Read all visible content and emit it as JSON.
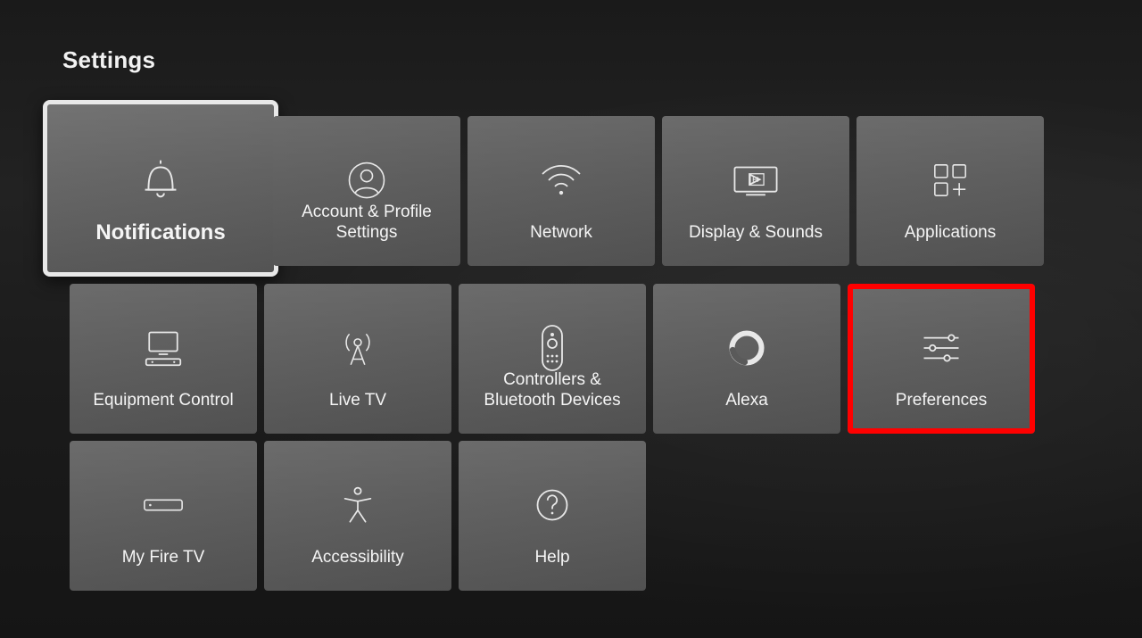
{
  "page": {
    "title": "Settings"
  },
  "tiles": [
    {
      "id": "notifications",
      "label": "Notifications",
      "icon": "bell-icon",
      "selected": true,
      "highlight": false
    },
    {
      "id": "account",
      "label": "Account & Profile Settings",
      "icon": "profile-icon",
      "selected": false,
      "highlight": false
    },
    {
      "id": "network",
      "label": "Network",
      "icon": "wifi-icon",
      "selected": false,
      "highlight": false
    },
    {
      "id": "display",
      "label": "Display & Sounds",
      "icon": "display-icon",
      "selected": false,
      "highlight": false
    },
    {
      "id": "applications",
      "label": "Applications",
      "icon": "apps-icon",
      "selected": false,
      "highlight": false
    },
    {
      "id": "equipment",
      "label": "Equipment Control",
      "icon": "equipment-icon",
      "selected": false,
      "highlight": false
    },
    {
      "id": "livetv",
      "label": "Live TV",
      "icon": "antenna-icon",
      "selected": false,
      "highlight": false
    },
    {
      "id": "controllers",
      "label": "Controllers & Bluetooth Devices",
      "icon": "remote-icon",
      "selected": false,
      "highlight": false
    },
    {
      "id": "alexa",
      "label": "Alexa",
      "icon": "alexa-icon",
      "selected": false,
      "highlight": false
    },
    {
      "id": "preferences",
      "label": "Preferences",
      "icon": "sliders-icon",
      "selected": false,
      "highlight": true
    },
    {
      "id": "myfiretv",
      "label": "My Fire TV",
      "icon": "device-icon",
      "selected": false,
      "highlight": false
    },
    {
      "id": "accessibility",
      "label": "Accessibility",
      "icon": "accessibility-icon",
      "selected": false,
      "highlight": false
    },
    {
      "id": "help",
      "label": "Help",
      "icon": "help-icon",
      "selected": false,
      "highlight": false
    }
  ],
  "colors": {
    "highlight": "#ff0000",
    "selected_border": "#e8e8e8",
    "text": "#f5f5f5"
  }
}
